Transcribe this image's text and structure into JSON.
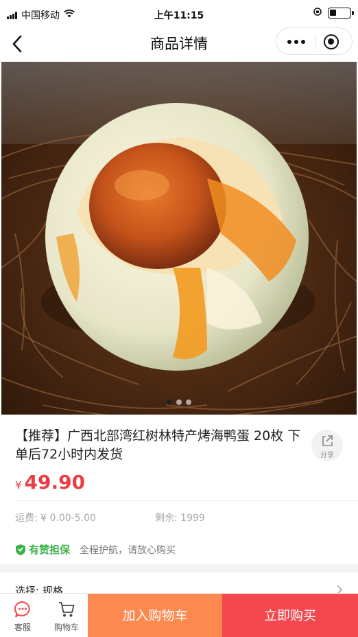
{
  "status_bar": {
    "carrier": "中国移动",
    "time": "上午11:15"
  },
  "nav": {
    "title": "商品详情"
  },
  "carousel": {
    "image_subject": "salted sea duck egg in nest",
    "active_index": 0,
    "count": 3
  },
  "product": {
    "title": "【推荐】广西北部湾红树林特产烤海鸭蛋 20枚 下单后72小时内发货",
    "currency_symbol": "¥",
    "price": "49.90",
    "shipping": "运费: ¥ 0.00-5.00",
    "stock": "剩余: 1999",
    "share_label": "分享"
  },
  "guarantee": {
    "badge": "有赞担保",
    "text": "全程护航，请放心购买"
  },
  "spec": {
    "label": "选择: 规格"
  },
  "bottom_bar": {
    "service_label": "客服",
    "cart_label": "购物车",
    "add_cart": "加入购物车",
    "buy_now": "立即购买"
  },
  "colors": {
    "price_red": "#ec3d45",
    "add_cart_orange": "#fc8a50",
    "buy_now_red": "#f5474e",
    "guarantee_green": "#3cb34a"
  },
  "icons": [
    "signal-icon",
    "wifi-icon",
    "lock-rotation-icon",
    "battery-icon",
    "back-arrow-icon",
    "more-dots-icon",
    "close-target-icon",
    "share-icon",
    "shield-check-icon",
    "chevron-right-icon",
    "chat-icon",
    "cart-icon"
  ]
}
